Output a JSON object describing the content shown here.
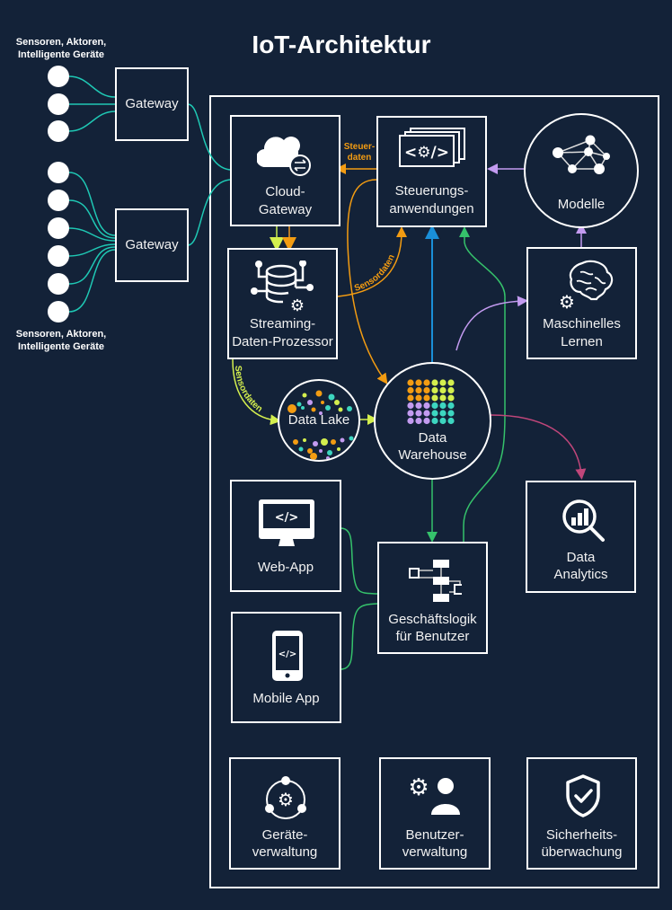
{
  "title": "IoT-Architektur",
  "devices": {
    "top_label": "Sensoren, Aktoren, Intelligente Geräte",
    "bottom_label": "Sensoren, Aktoren, Intelligente Geräte",
    "top_group_count": 3,
    "bottom_group_count": 6
  },
  "gateways": [
    {
      "label": "Gateway"
    },
    {
      "label": "Gateway"
    }
  ],
  "nodes": {
    "cloud_gateway": {
      "label1": "Cloud-",
      "label2": "Gateway",
      "icon": "cloud-sync-icon"
    },
    "control_apps": {
      "label1": "Steuerungs-",
      "label2": "anwendungen",
      "icon": "code-window-icon"
    },
    "models": {
      "label": "Modelle",
      "icon": "network-graph-icon"
    },
    "stream_processor": {
      "label1": "Streaming-",
      "label2": "Daten-Prozessor",
      "icon": "database-gear-icon"
    },
    "machine_learning": {
      "label1": "Maschinelles",
      "label2": "Lernen",
      "icon": "brain-gear-icon"
    },
    "data_lake": {
      "label": "Data Lake",
      "icon": "dots-icon"
    },
    "data_warehouse": {
      "label1": "Data",
      "label2": "Warehouse",
      "icon": "dot-grid-icon"
    },
    "data_analytics": {
      "label1": "Data",
      "label2": "Analytics",
      "icon": "magnifier-chart-icon"
    },
    "web_app": {
      "label": "Web-App",
      "icon": "monitor-code-icon"
    },
    "mobile_app": {
      "label": "Mobile App",
      "icon": "phone-code-icon"
    },
    "business_logic": {
      "label1": "Geschäftslogik",
      "label2": "für Benutzer",
      "icon": "flowchart-icon"
    },
    "device_mgmt": {
      "label1": "Geräte-",
      "label2": "verwaltung",
      "icon": "device-gear-icon"
    },
    "user_mgmt": {
      "label1": "Benutzer-",
      "label2": "verwaltung",
      "icon": "user-gear-icon"
    },
    "security": {
      "label1": "Sicherheits-",
      "label2": "überwachung",
      "icon": "shield-check-icon"
    }
  },
  "annotations": {
    "control_data_1": "Steuer-",
    "control_data_2": "daten",
    "sensor_data_a": "Sensordaten",
    "sensor_data_b": "Sensordaten"
  },
  "colors": {
    "background": "#132238",
    "device_link": "#1fc8b4",
    "orange": "#f39c12",
    "lime": "#d4ef4e",
    "blue": "#1a8fd8",
    "green": "#35c26b",
    "purple": "#c39bf0",
    "magenta": "#c0467a",
    "teal": "#3dd6c0"
  }
}
